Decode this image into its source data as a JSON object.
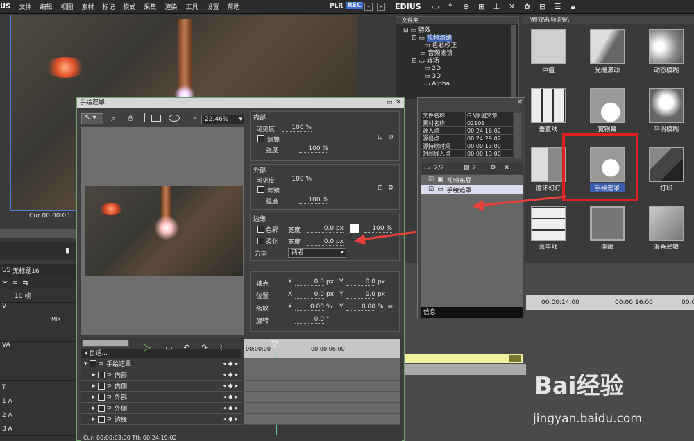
{
  "menubar": {
    "logo": "US",
    "items": [
      "文件",
      "编辑",
      "视图",
      "素材",
      "标记",
      "模式",
      "采集",
      "渲染",
      "工具",
      "设置",
      "帮助"
    ],
    "plr": "PLR",
    "rec": "REC"
  },
  "preview": {
    "timecode": "Cur 00:00:03:"
  },
  "right_toolbar": {
    "logo": "EDIUS"
  },
  "folder_pane": {
    "header": "文件夹",
    "items": [
      {
        "label": "特效",
        "indent": 1
      },
      {
        "label": "视频滤镜",
        "indent": 2,
        "selected": true
      },
      {
        "label": "色彩校正",
        "indent": 3
      },
      {
        "label": "音频滤镜",
        "indent": 2
      },
      {
        "label": "转场",
        "indent": 2
      },
      {
        "label": "2D",
        "indent": 3
      },
      {
        "label": "3D",
        "indent": 3
      },
      {
        "label": "Alpha",
        "indent": 3
      }
    ]
  },
  "effects_pane": {
    "path": "\\特效\\视频滤镜\\",
    "items": [
      {
        "label": "中值"
      },
      {
        "label": "光栅滚动"
      },
      {
        "label": "动态模糊"
      },
      {
        "label": "垂直线"
      },
      {
        "label": "宽银幕"
      },
      {
        "label": "平滑模糊"
      },
      {
        "label": "循环幻灯"
      },
      {
        "label": "手绘遮罩",
        "selected": true
      },
      {
        "label": "打印"
      },
      {
        "label": "水平线"
      },
      {
        "label": "浮雕"
      },
      {
        "label": "混合滤镜"
      }
    ]
  },
  "dialog": {
    "title": "手绘遮罩",
    "zoom": "22.46%",
    "inner": {
      "title": "内部",
      "visibility_label": "可见度",
      "visibility": "100 %",
      "filter_label": "滤镜",
      "strength_label": "强度",
      "strength": "100 %"
    },
    "outer": {
      "title": "外部",
      "visibility_label": "可见度",
      "visibility": "100 %",
      "filter_label": "滤镜",
      "strength_label": "强度",
      "strength": "100 %"
    },
    "edge": {
      "title": "边缘",
      "color_label": "色彩",
      "width_label": "宽度",
      "color_width": "0.0 px",
      "color_pct": "100 %",
      "soft_label": "柔化",
      "soft_width": "0.0 px",
      "direction_label": "方向",
      "direction": "两者"
    },
    "transform": {
      "anchor_label": "轴点",
      "position_label": "位置",
      "scale_label": "缩放",
      "rotate_label": "旋转",
      "x": "X",
      "y": "Y",
      "anchor_x": "0.0",
      "anchor_y": "0.0",
      "pos_x": "0.0",
      "pos_y": "0.0",
      "scale_x": "0.00",
      "scale_y": "0.00",
      "rotate": "0.0",
      "unit_px": "px",
      "unit_pct": "%",
      "unit_deg": "°"
    },
    "keyframes": {
      "auto": "自适...",
      "tracks": [
        "手绘遮罩",
        "内部",
        "内侧",
        "外部",
        "外侧",
        "边缘"
      ],
      "ruler": [
        "00:00:00",
        "00:00:06:00"
      ],
      "footer": "Cur: 00:00:03:00  Ttl: 00:24:19:02"
    }
  },
  "info_window": {
    "rows": [
      [
        "文件名称",
        "G:\\原创文章..."
      ],
      [
        "素材名称",
        "02101"
      ],
      [
        "源入点",
        "00:24:16:02"
      ],
      [
        "源出点",
        "00:24:29:02"
      ],
      [
        "源持续时间",
        "00:00:13:00"
      ],
      [
        "时间线入点",
        "00:00:13:00"
      ]
    ],
    "page": "2/2",
    "layer_count": "2",
    "layers": [
      {
        "label": "视频布局",
        "checked": true
      },
      {
        "label": "手绘遮罩",
        "checked": true,
        "selected": true
      }
    ],
    "footer": "信息"
  },
  "timeline": {
    "project": "无标题16",
    "zoom": "10 帧",
    "tracks": [
      "V",
      "VA",
      "T",
      "1 A",
      "2 A",
      "3 A"
    ],
    "mix": "MIX",
    "ruler": [
      "00:00:14:00",
      "00:00:16:00",
      "00:00:"
    ]
  },
  "watermark": {
    "brand": "Bai经验",
    "url": "jingyan.baidu.com"
  },
  "colors": {
    "accent": "#3a5fb0",
    "highlight": "#e02020",
    "arrow": "#e8403a"
  }
}
